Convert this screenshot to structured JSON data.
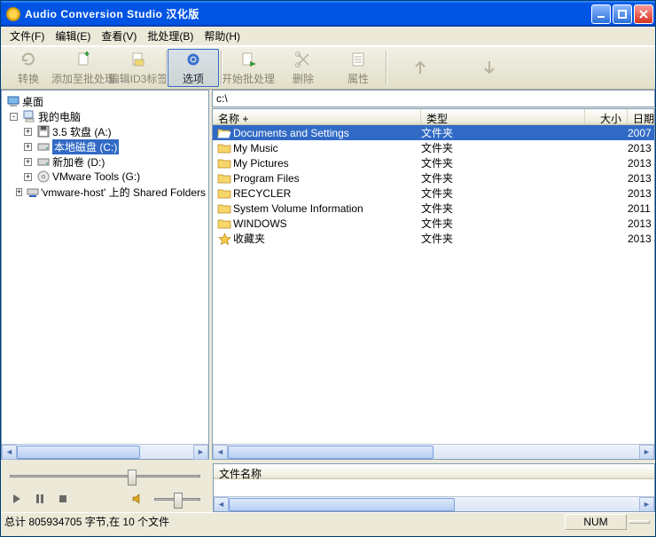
{
  "title": "Audio Conversion Studio 汉化版",
  "menu": [
    "文件(F)",
    "编辑(E)",
    "查看(V)",
    "批处理(B)",
    "帮助(H)"
  ],
  "toolbar": [
    {
      "id": "convert",
      "label": "转换",
      "icon": "refresh",
      "active": false
    },
    {
      "id": "addbatch",
      "label": "添加至批处理",
      "icon": "plus-doc",
      "active": false
    },
    {
      "id": "editid3",
      "label": "编辑ID3标签",
      "icon": "tag",
      "active": false
    },
    {
      "id": "options",
      "label": "选项",
      "icon": "gear",
      "active": true,
      "sep": true
    },
    {
      "id": "startbatch",
      "label": "开始批处理",
      "icon": "play-doc",
      "active": false,
      "sep": true
    },
    {
      "id": "delete",
      "label": "删除",
      "icon": "scissors",
      "active": false
    },
    {
      "id": "props",
      "label": "属性",
      "icon": "props",
      "active": false
    },
    {
      "id": "up",
      "label": "",
      "icon": "arrow-up",
      "active": false,
      "sep": true,
      "wide": true
    },
    {
      "id": "down",
      "label": "",
      "icon": "arrow-down",
      "active": false,
      "wide": true
    }
  ],
  "tree": {
    "root": "桌面",
    "mycomp": "我的电脑",
    "drives": [
      {
        "label": "3.5 软盘 (A:)",
        "icon": "floppy"
      },
      {
        "label": "本地磁盘 (C:)",
        "icon": "hdd",
        "selected": true
      },
      {
        "label": "新加卷 (D:)",
        "icon": "hdd"
      },
      {
        "label": "VMware Tools (G:)",
        "icon": "cd"
      },
      {
        "label": "'vmware-host' 上的 Shared Folders",
        "icon": "netdrive"
      }
    ]
  },
  "path": "c:\\",
  "columns": {
    "name": "名称 +",
    "type": "类型",
    "size": "大小",
    "date": "日期"
  },
  "files": [
    {
      "name": "Documents and Settings",
      "type": "文件夹",
      "date": "2007",
      "sel": true,
      "icon": "folder-open"
    },
    {
      "name": "My Music",
      "type": "文件夹",
      "date": "2013",
      "icon": "folder"
    },
    {
      "name": "My Pictures",
      "type": "文件夹",
      "date": "2013",
      "icon": "folder"
    },
    {
      "name": "Program Files",
      "type": "文件夹",
      "date": "2013",
      "icon": "folder"
    },
    {
      "name": "RECYCLER",
      "type": "文件夹",
      "date": "2013",
      "icon": "folder"
    },
    {
      "name": "System Volume Information",
      "type": "文件夹",
      "date": "2011",
      "icon": "folder"
    },
    {
      "name": "WINDOWS",
      "type": "文件夹",
      "date": "2013",
      "icon": "folder"
    },
    {
      "name": "收藏夹",
      "type": "文件夹",
      "date": "2013",
      "icon": "star"
    }
  ],
  "bottom_col": "文件名称",
  "status": {
    "left": "总计 805934705 字节,在 10 个文件",
    "num": "NUM"
  }
}
